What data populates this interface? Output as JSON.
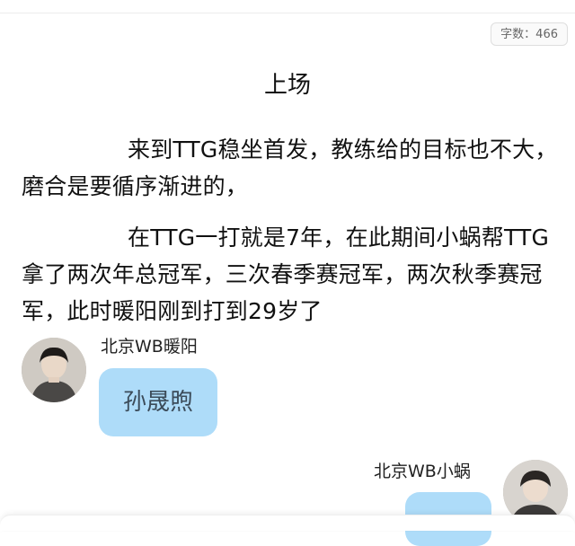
{
  "header": {
    "word_count_label": "字数：466"
  },
  "article": {
    "title": "上场",
    "paragraphs": [
      "来到TTG稳坐首发，教练给的目标也不大，磨合是要循序渐进的，",
      "在TTG一打就是7年，在此期间小蜗帮TTG拿了两次年总冠军，三次春季赛冠军，两次秋季赛冠军，此时暖阳刚到打到29岁了"
    ]
  },
  "chat": [
    {
      "user": "北京WB暖阳",
      "message": "孙晟煦",
      "side": "left"
    },
    {
      "user": "北京WB小蜗",
      "message": "",
      "side": "right"
    }
  ],
  "colors": {
    "bubble": "#aedcf9",
    "bubble_text": "#3b4b59"
  }
}
